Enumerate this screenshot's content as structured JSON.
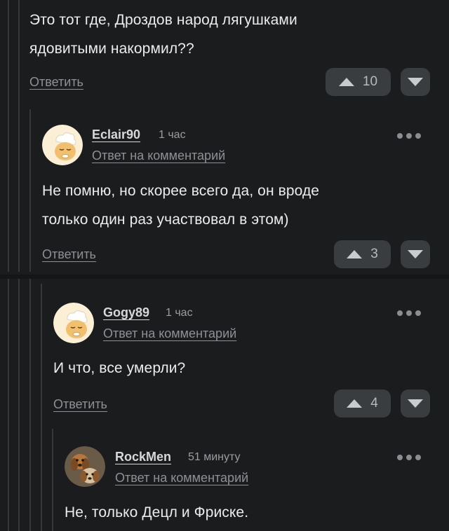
{
  "comment1": {
    "text_line1": "Это тот где, Дроздов народ лягушками",
    "text_line2": "ядовитыми накормил??",
    "reply_label": "Ответить",
    "votes": "10"
  },
  "comment2": {
    "username": "Eclair90",
    "time": "1 час",
    "reply_to": "Ответ на комментарий",
    "text_line1": "Не помню, но скорее всего да, он вроде",
    "text_line2": "только один раз участвовал в этом)",
    "reply_label": "Ответить",
    "votes": "3",
    "avatar_icon": "baby-avatar-icon"
  },
  "comment3": {
    "username": "Gogy89",
    "time": "1 час",
    "reply_to": "Ответ на комментарий",
    "text_line1": "И что, все умерли?",
    "reply_label": "Ответить",
    "votes": "4",
    "avatar_icon": "baby-avatar-icon"
  },
  "comment4": {
    "username": "RockMen",
    "time": "51 минуту",
    "reply_to": "Ответ на комментарий",
    "text_line1": "Не, только Децл и Фриске.",
    "avatar_icon": "dogs-avatar-icon"
  },
  "colors": {
    "background": "#1b1c1e",
    "button": "#3a3d40",
    "avatar_bg": "#fbefd6"
  }
}
